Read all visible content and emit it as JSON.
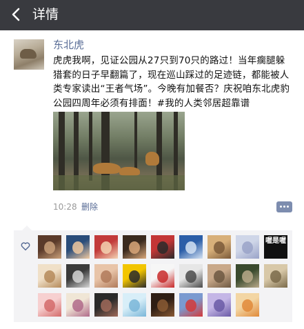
{
  "nav": {
    "back_icon": "chevron-left-icon",
    "title": "详情",
    "bg": "#393a3f"
  },
  "post": {
    "username": "东北虎",
    "text": "虎虎我啊，见证公园从27只到70只的路过！当年瘸腿躲猎套的日子早翻篇了，现在巡山踩过的足迹链，都能被人类专家读出“王者气场”。今晚有加餐否？庆祝咱东北虎豹公园四周年必须有排面！#我的人类邻居超靠谱",
    "time": "10:28",
    "delete_label": "删除",
    "comment_icon": "comment-icon"
  },
  "likes": {
    "heart_icon": "heart-icon",
    "count": 26,
    "badge_text": "喔是喔"
  },
  "colors": {
    "link": "#576b95",
    "panel": "#f3f3f5",
    "accent": "#7d8daf"
  }
}
